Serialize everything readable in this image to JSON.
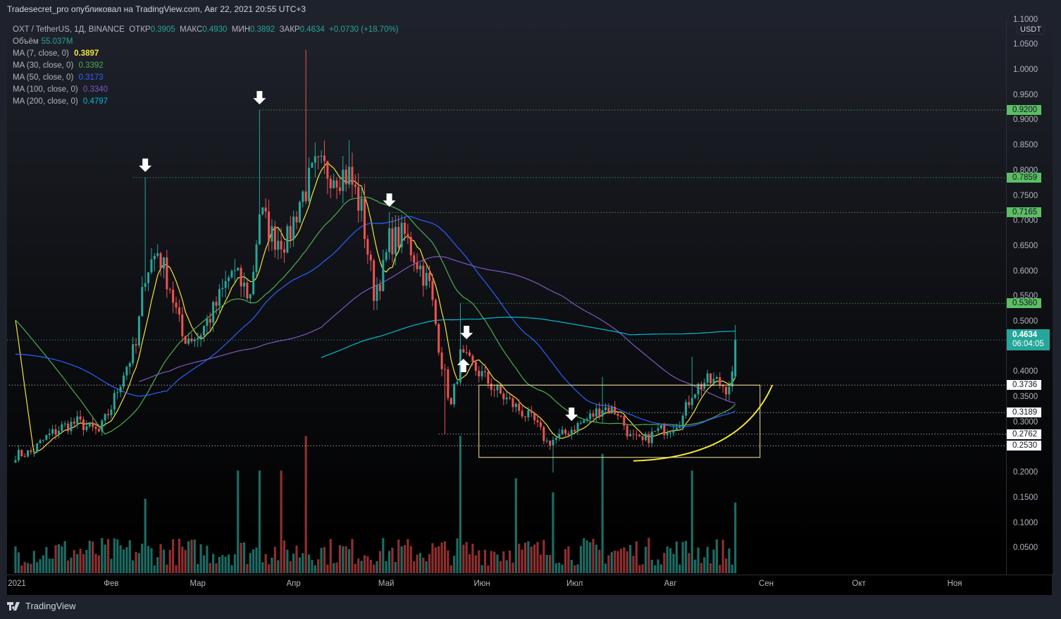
{
  "header": {
    "published": "Tradesecret_pro опубликовал на TradingView.com, Авг 22, 2021 20:55 UTC+3"
  },
  "legend": {
    "symbol": "OXT / TetherUS, 1Д, BINANCE",
    "open_label": "ОТКР",
    "open": "0.3905",
    "high_label": "МАКС",
    "high": "0.4930",
    "low_label": "МИН",
    "low": "0.3892",
    "close_label": "ЗАКР",
    "close": "0.4634",
    "change": "+0.0730 (+18.70%)",
    "volume_label": "Объём",
    "volume": "55.037M",
    "ma": [
      {
        "label": "MA (7, close, 0)",
        "value": "0.3897",
        "color": "#f5e33b",
        "period": 7
      },
      {
        "label": "MA (30, close, 0)",
        "value": "0.3392",
        "color": "#4caf50",
        "period": 30
      },
      {
        "label": "MA (50, close, 0)",
        "value": "0.3173",
        "color": "#2962ff",
        "period": 50
      },
      {
        "label": "MA (100, close, 0)",
        "value": "0.3340",
        "color": "#7e57c2",
        "period": 100
      },
      {
        "label": "MA (200, close, 0)",
        "value": "0.4797",
        "color": "#00bcd4",
        "period": 200
      }
    ]
  },
  "price_axis": {
    "unit": "USDT",
    "ticks": [
      "1.1000",
      "1.0500",
      "1.0000",
      "0.9500",
      "0.9000",
      "0.8500",
      "0.8000",
      "0.7500",
      "0.7000",
      "0.6500",
      "0.6000",
      "0.5500",
      "0.5000",
      "0.4000",
      "0.3500",
      "0.3000",
      "0.2000",
      "0.1500",
      "0.1000",
      "0.0500"
    ],
    "current_price": "0.4634",
    "countdown": "06:04:05"
  },
  "levels": [
    {
      "value": "0.9200",
      "style": "green",
      "from_day": 79
    },
    {
      "value": "0.7859",
      "style": "green",
      "from_day": 38
    },
    {
      "value": "0.7165",
      "style": "green",
      "from_day": 121
    },
    {
      "value": "0.5360",
      "style": "green",
      "from_day": 144
    },
    {
      "value": "0.3736",
      "style": "white",
      "from_day": -3
    },
    {
      "value": "0.3189",
      "style": "white",
      "from_day": 185
    },
    {
      "value": "0.2762",
      "style": "white",
      "from_day": 137
    },
    {
      "value": "0.2530",
      "style": "white",
      "from_day": -3
    }
  ],
  "time_axis": [
    {
      "label": "2021",
      "day": 0
    },
    {
      "label": "Фев",
      "day": 31
    },
    {
      "label": "Мар",
      "day": 59
    },
    {
      "label": "Апр",
      "day": 90
    },
    {
      "label": "Май",
      "day": 120
    },
    {
      "label": "Июн",
      "day": 151
    },
    {
      "label": "Июл",
      "day": 181
    },
    {
      "label": "Авг",
      "day": 212
    },
    {
      "label": "Сен",
      "day": 243
    },
    {
      "label": "Окт",
      "day": 273
    },
    {
      "label": "Ноя",
      "day": 304
    }
  ],
  "footer": {
    "brand": "TradingView"
  },
  "colors": {
    "up": "#26a69a",
    "down": "#ef5350",
    "vol_up": "#1d6b63",
    "vol_down": "#8e2f2f",
    "level_green": "#5bbf63",
    "annotation": "#f5e33b"
  },
  "chart_data": {
    "type": "candlestick",
    "title": "OXT / TetherUS, 1Д, BINANCE",
    "ylabel": "USDT",
    "ylim": [
      0,
      1.1
    ],
    "x_unit": "day of 2021 (0 = Jan 1)",
    "close_keypoints": [
      [
        0,
        0.235
      ],
      [
        5,
        0.24
      ],
      [
        10,
        0.27
      ],
      [
        15,
        0.29
      ],
      [
        20,
        0.3
      ],
      [
        27,
        0.28
      ],
      [
        31,
        0.33
      ],
      [
        35,
        0.4
      ],
      [
        39,
        0.45
      ],
      [
        42,
        0.6
      ],
      [
        46,
        0.64
      ],
      [
        50,
        0.57
      ],
      [
        54,
        0.47
      ],
      [
        59,
        0.47
      ],
      [
        64,
        0.52
      ],
      [
        70,
        0.6
      ],
      [
        76,
        0.55
      ],
      [
        79,
        0.72
      ],
      [
        83,
        0.67
      ],
      [
        88,
        0.66
      ],
      [
        92,
        0.74
      ],
      [
        97,
        0.8
      ],
      [
        102,
        0.8
      ],
      [
        108,
        0.79
      ],
      [
        112,
        0.72
      ],
      [
        116,
        0.56
      ],
      [
        119,
        0.6
      ],
      [
        121,
        0.66
      ],
      [
        126,
        0.67
      ],
      [
        130,
        0.62
      ],
      [
        134,
        0.57
      ],
      [
        138,
        0.42
      ],
      [
        141,
        0.33
      ],
      [
        144,
        0.43
      ],
      [
        150,
        0.4
      ],
      [
        156,
        0.36
      ],
      [
        162,
        0.33
      ],
      [
        168,
        0.3
      ],
      [
        172,
        0.26
      ],
      [
        176,
        0.27
      ],
      [
        181,
        0.29
      ],
      [
        186,
        0.31
      ],
      [
        190,
        0.33
      ],
      [
        195,
        0.32
      ],
      [
        199,
        0.27
      ],
      [
        203,
        0.26
      ],
      [
        207,
        0.28
      ],
      [
        212,
        0.29
      ],
      [
        216,
        0.31
      ],
      [
        219,
        0.36
      ],
      [
        223,
        0.38
      ],
      [
        227,
        0.38
      ],
      [
        230,
        0.37
      ],
      [
        232,
        0.39
      ],
      [
        233,
        0.4634
      ]
    ],
    "high_spikes": [
      [
        42,
        0.7859
      ],
      [
        79,
        0.92
      ],
      [
        94,
        1.04
      ],
      [
        108,
        0.86
      ],
      [
        121,
        0.7165
      ],
      [
        144,
        0.536
      ],
      [
        190,
        0.39
      ],
      [
        219,
        0.43
      ]
    ],
    "low_spikes": [
      [
        139,
        0.276
      ],
      [
        174,
        0.2
      ]
    ],
    "volume_unit": "M",
    "volume_spikes": [
      [
        42,
        58
      ],
      [
        72,
        80
      ],
      [
        79,
        80
      ],
      [
        86,
        80
      ],
      [
        94,
        107
      ],
      [
        144,
        107
      ],
      [
        162,
        74
      ],
      [
        174,
        63
      ],
      [
        190,
        93
      ],
      [
        219,
        80
      ],
      [
        233,
        55.037
      ]
    ],
    "current_ma_values": {
      "ma7": 0.3897,
      "ma30": 0.3392,
      "ma50": 0.3173,
      "ma100": 0.334,
      "ma200": 0.4797
    },
    "grid": false
  },
  "annotations": {
    "down_arrows_days": [
      42,
      79,
      121,
      146,
      180
    ],
    "up_arrow_days": [
      145
    ],
    "range_box": {
      "day_from": 150,
      "day_to": 241,
      "price_top": 0.3736,
      "price_bottom": 0.23
    },
    "curve": {
      "day_from": 200,
      "day_to": 245,
      "price_from": 0.223,
      "price_to": 0.374
    }
  }
}
